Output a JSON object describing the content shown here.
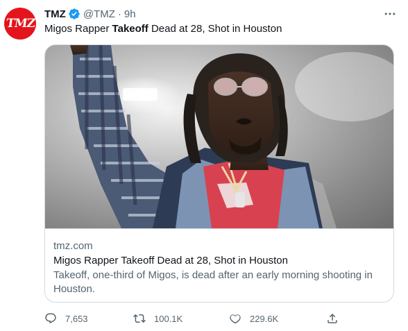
{
  "tweet": {
    "author_name": "TMZ",
    "handle": "@TMZ",
    "separator": "·",
    "time": "9h",
    "avatar_text": "TMZ",
    "text_before": "Migos Rapper ",
    "text_bold": "Takeoff",
    "text_after": " Dead at 28, Shot in Houston",
    "verified_icon": "verified-badge-icon",
    "more_icon": "more-options-icon"
  },
  "card": {
    "domain": "tmz.com",
    "title": "Migos Rapper Takeoff Dead at 28, Shot in Houston",
    "description": "Takeoff, one-third of Migos, is dead after an early morning shooting in Houston.",
    "image_alt": "Takeoff performing on stage wearing round glasses and a denim plaid jacket, arm raised"
  },
  "actions": {
    "reply_count": "7,653",
    "retweet_count": "100.1K",
    "like_count": "229.6K",
    "reply_icon": "reply-icon",
    "retweet_icon": "retweet-icon",
    "like_icon": "heart-icon",
    "share_icon": "share-icon"
  },
  "colors": {
    "verified": "#1d9bf0",
    "avatar_bg": "#e3141c",
    "secondary_text": "#536471",
    "primary_text": "#0f1419",
    "border": "#cfd9de"
  }
}
